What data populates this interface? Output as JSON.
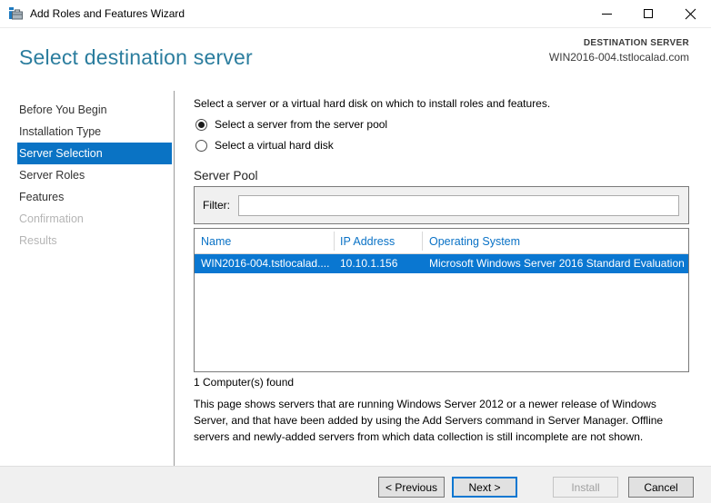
{
  "window": {
    "title": "Add Roles and Features Wizard",
    "icons": {
      "app": "server-manager-toolbox",
      "minimize": "minimize-line",
      "maximize": "maximize-square",
      "close": "close-x"
    }
  },
  "header": {
    "title": "Select destination server",
    "destination_label": "DESTINATION SERVER",
    "destination_server": "WIN2016-004.tstlocalad.com"
  },
  "sidebar": {
    "items": [
      {
        "label": "Before You Begin",
        "state": "normal"
      },
      {
        "label": "Installation Type",
        "state": "normal"
      },
      {
        "label": "Server Selection",
        "state": "selected"
      },
      {
        "label": "Server Roles",
        "state": "normal"
      },
      {
        "label": "Features",
        "state": "normal"
      },
      {
        "label": "Confirmation",
        "state": "disabled"
      },
      {
        "label": "Results",
        "state": "disabled"
      }
    ]
  },
  "main": {
    "intro": "Select a server or a virtual hard disk on which to install roles and features.",
    "radios": [
      {
        "label": "Select a server from the server pool",
        "selected": true
      },
      {
        "label": "Select a virtual hard disk",
        "selected": false
      }
    ],
    "server_pool": {
      "section_label": "Server Pool",
      "filter_label": "Filter:",
      "filter_value": "",
      "table": {
        "columns": [
          "Name",
          "IP Address",
          "Operating System"
        ],
        "rows": [
          {
            "name": "WIN2016-004.tstlocalad....",
            "ip": "10.10.1.156",
            "os": "Microsoft Windows Server 2016 Standard Evaluation",
            "selected": true
          }
        ]
      },
      "count_text": "1 Computer(s) found"
    },
    "note": "This page shows servers that are running Windows Server 2012 or a newer release of Windows Server, and that have been added by using the Add Servers command in Server Manager. Offline servers and newly-added servers from which data collection is still incomplete are not shown."
  },
  "footer": {
    "buttons": [
      {
        "label": "< Previous",
        "state": "normal"
      },
      {
        "label": "Next >",
        "state": "default"
      },
      {
        "label": "Install",
        "state": "disabled"
      },
      {
        "label": "Cancel",
        "state": "normal"
      }
    ]
  },
  "colors": {
    "accent_blue": "#0a73c4",
    "row_selection_blue": "#0a77d1",
    "heading_teal": "#2b7d9e",
    "table_header_blue": "#0a72c6",
    "disabled_text": "#b5b5b5",
    "footer_gray": "#f0f0f0"
  }
}
